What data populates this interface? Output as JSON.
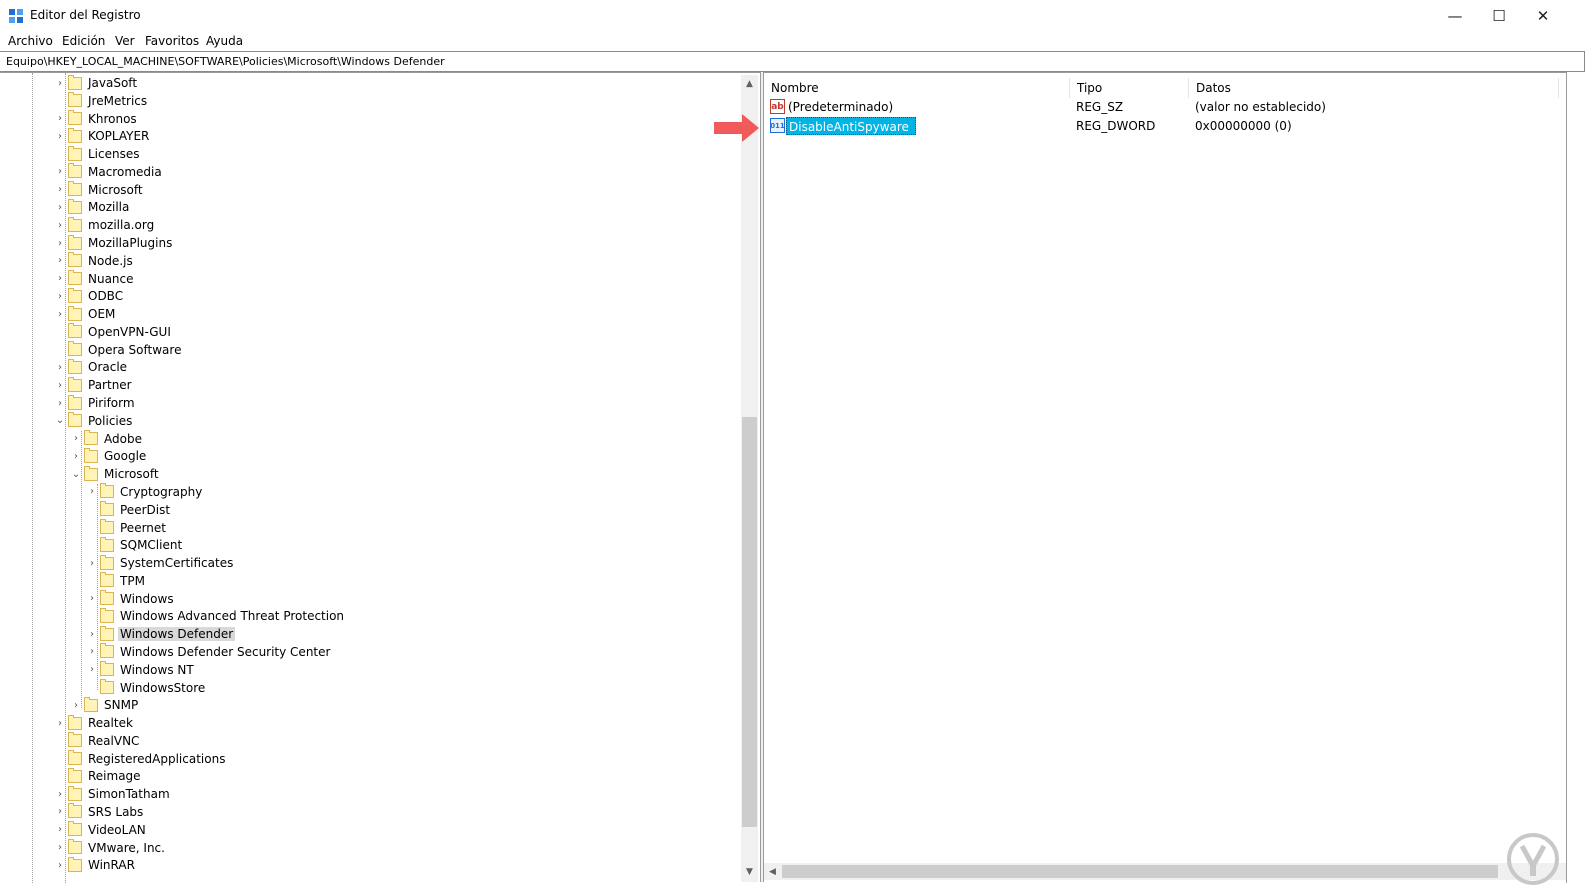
{
  "window": {
    "title": "Editor del Registro",
    "minimize": "—",
    "maximize": "☐",
    "close": "✕"
  },
  "menu": [
    "Archivo",
    "Edición",
    "Ver",
    "Favoritos",
    "Ayuda"
  ],
  "address": "Equipo\\HKEY_LOCAL_MACHINE\\SOFTWARE\\Policies\\Microsoft\\Windows Defender",
  "tree": [
    {
      "label": "JavaSoft",
      "expander": "›"
    },
    {
      "label": "JreMetrics",
      "expander": ""
    },
    {
      "label": "Khronos",
      "expander": "›"
    },
    {
      "label": "KOPLAYER",
      "expander": "›"
    },
    {
      "label": "Licenses",
      "expander": ""
    },
    {
      "label": "Macromedia",
      "expander": "›"
    },
    {
      "label": "Microsoft",
      "expander": "›"
    },
    {
      "label": "Mozilla",
      "expander": "›"
    },
    {
      "label": "mozilla.org",
      "expander": "›"
    },
    {
      "label": "MozillaPlugins",
      "expander": "›"
    },
    {
      "label": "Node.js",
      "expander": "›"
    },
    {
      "label": "Nuance",
      "expander": "›"
    },
    {
      "label": "ODBC",
      "expander": "›"
    },
    {
      "label": "OEM",
      "expander": "›"
    },
    {
      "label": "OpenVPN-GUI",
      "expander": ""
    },
    {
      "label": "Opera Software",
      "expander": ""
    },
    {
      "label": "Oracle",
      "expander": "›"
    },
    {
      "label": "Partner",
      "expander": "›"
    },
    {
      "label": "Piriform",
      "expander": "›"
    },
    {
      "label": "Policies",
      "expander": "⌄"
    },
    {
      "label": "Adobe",
      "expander": "›"
    },
    {
      "label": "Google",
      "expander": "›"
    },
    {
      "label": "Microsoft",
      "expander": "⌄"
    },
    {
      "label": "Cryptography",
      "expander": "›"
    },
    {
      "label": "PeerDist",
      "expander": ""
    },
    {
      "label": "Peernet",
      "expander": ""
    },
    {
      "label": "SQMClient",
      "expander": ""
    },
    {
      "label": "SystemCertificates",
      "expander": "›"
    },
    {
      "label": "TPM",
      "expander": ""
    },
    {
      "label": "Windows",
      "expander": "›"
    },
    {
      "label": "Windows Advanced Threat Protection",
      "expander": ""
    },
    {
      "label": "Windows Defender",
      "expander": "›"
    },
    {
      "label": "Windows Defender Security Center",
      "expander": "›"
    },
    {
      "label": "Windows NT",
      "expander": "›"
    },
    {
      "label": "WindowsStore",
      "expander": ""
    },
    {
      "label": "SNMP",
      "expander": "›"
    },
    {
      "label": "Realtek",
      "expander": "›"
    },
    {
      "label": "RealVNC",
      "expander": ""
    },
    {
      "label": "RegisteredApplications",
      "expander": ""
    },
    {
      "label": "Reimage",
      "expander": ""
    },
    {
      "label": "SimonTatham",
      "expander": "›"
    },
    {
      "label": "SRS Labs",
      "expander": "›"
    },
    {
      "label": "VideoLAN",
      "expander": "›"
    },
    {
      "label": "VMware, Inc.",
      "expander": "›"
    },
    {
      "label": "WinRAR",
      "expander": "›"
    }
  ],
  "list": {
    "columns": [
      "Nombre",
      "Tipo",
      "Datos"
    ],
    "rows": [
      {
        "icon": "ab",
        "name": "(Predeterminado)",
        "type": "REG_SZ",
        "data": "(valor no establecido)"
      },
      {
        "icon": "011",
        "name": "DisableAntiSpyware",
        "type": "REG_DWORD",
        "data": "0x00000000 (0)"
      }
    ]
  },
  "scroll": {
    "up": "▲",
    "down": "▼",
    "left": "◀"
  },
  "colors": {
    "selection": "#00b4e6",
    "arrow": "#f05a5a",
    "folder": "#fff3b5"
  }
}
